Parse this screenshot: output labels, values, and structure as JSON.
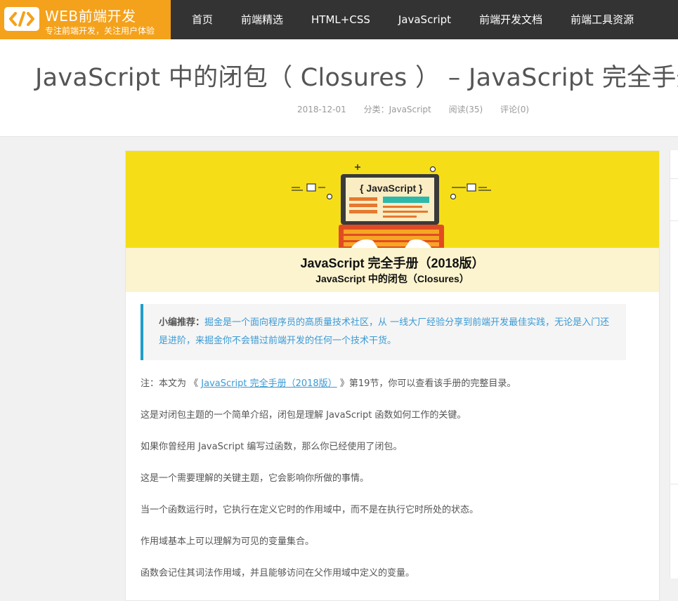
{
  "site": {
    "title": "WEB前端开发",
    "slogan": "专注前端开发，关注用户体验",
    "logo_icon": "code-brackets-icon"
  },
  "nav": [
    "首页",
    "前端精选",
    "HTML+CSS",
    "JavaScript",
    "前端开发文档",
    "前端工具资源"
  ],
  "post": {
    "title": "JavaScript 中的闭包（ Closures ） – JavaScript 完全手册",
    "date": "2018-12-01",
    "category": "分类：JavaScript",
    "views": "阅读(35)",
    "comments": "评论(0)"
  },
  "banner": {
    "screen_text": "{ JavaScript }",
    "line1": "JavaScript 完全手册（2018版）",
    "line2": "JavaScript 中的闭包（Closures）"
  },
  "recommend": {
    "label": "小编推荐：",
    "text": "掘金是一个面向程序员的高质量技术社区，从 一线大厂经验分享到前端开发最佳实践，无论是入门还是进阶，来掘金你不会错过前端开发的任何一个技术干货。"
  },
  "paragraphs": {
    "p1_prefix": "注：本文为 《",
    "p1_link": "JavaScript 完全手册（2018版）",
    "p1_suffix": "》第19节，你可以查看该手册的完整目录。",
    "p2": "这是对闭包主题的一个简单介绍，闭包是理解 JavaScript 函数如何工作的关键。",
    "p3": "如果你曾经用 JavaScript 编写过函数，那么你已经使用了闭包。",
    "p4": "这是一个需要理解的关键主题，它会影响你所做的事情。",
    "p5": "当一个函数运行时，它执行在定义它时的作用域中，而不是在执行它时所处的状态。",
    "p6": "作用域基本上可以理解为可见的变量集合。",
    "p7": "函数会记住其词法作用域，并且能够访问在父作用域中定义的变量。"
  },
  "colors": {
    "nav_bg": "#333333",
    "logo_bg": "#f4a11b",
    "accent": "#3a9ad5",
    "banner_yellow": "#f5de17"
  }
}
